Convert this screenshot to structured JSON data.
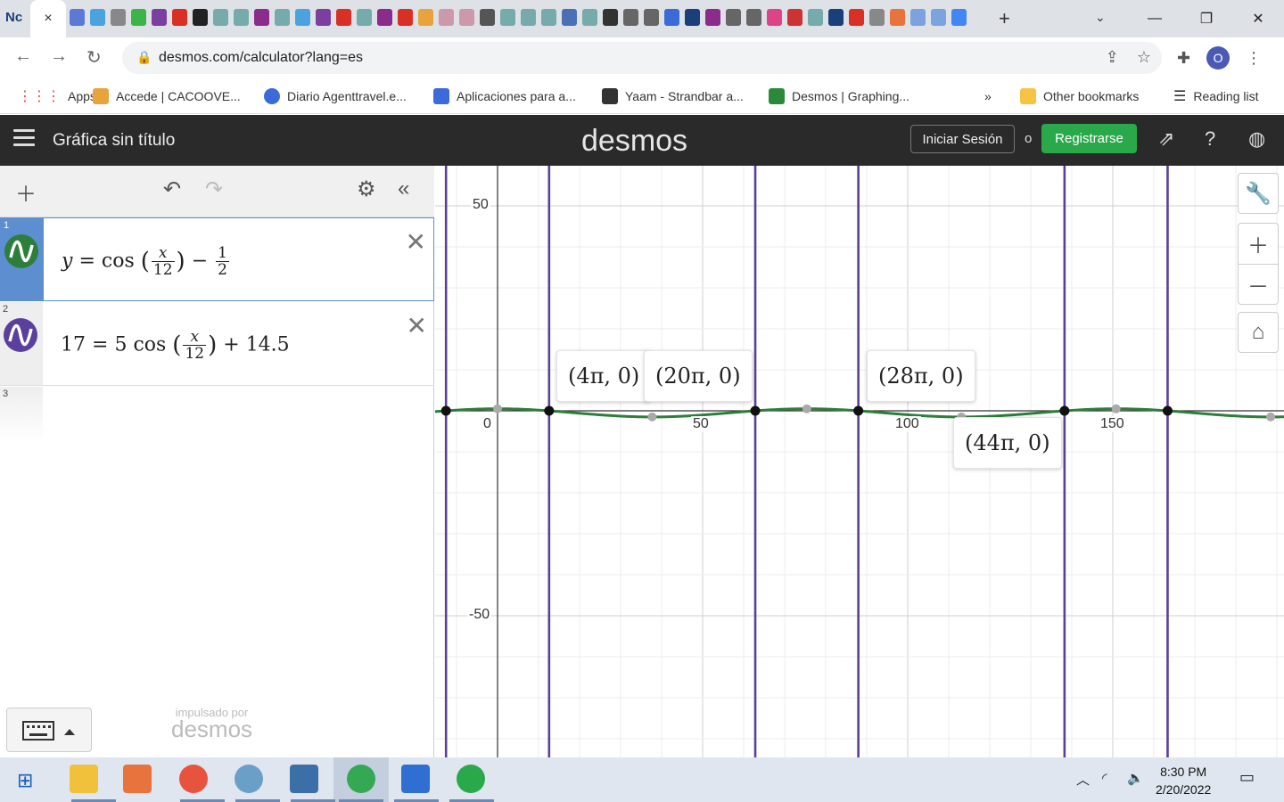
{
  "browser": {
    "active_tab_favicon": "Nc",
    "active_tab_close": "×",
    "url": "desmos.com/calculator?lang=es",
    "new_tab": "+",
    "minimize": "—",
    "restore": "❐",
    "close": "✕",
    "tab_search": "⌄",
    "profile_initial": "O",
    "bookmarks": [
      {
        "label": "Apps",
        "color": "#e94235"
      },
      {
        "label": "Accede | CACOOVE...",
        "color": "#e8a33d"
      },
      {
        "label": "Diario Agenttravel.e...",
        "color": "#3a6bd8"
      },
      {
        "label": "Aplicaciones para a...",
        "color": "#3a6bd8"
      },
      {
        "label": "Yaam - Strandbar a...",
        "color": "#333333"
      },
      {
        "label": "Desmos | Graphing...",
        "color": "#2a8a3a"
      }
    ],
    "more_bookmarks": "»",
    "other_bookmarks": "Other bookmarks",
    "reading_list": "Reading list"
  },
  "desmos_header": {
    "graph_title": "Gráfica sin título",
    "logo": "desmos",
    "login": "Iniciar Sesión",
    "or": "o",
    "register": "Registrarse",
    "accent": "#2aa94b"
  },
  "expressions": [
    {
      "index": "1",
      "color": "#2d7e3a",
      "active": true
    },
    {
      "index": "2",
      "color": "#5b3f9c",
      "active": false
    },
    {
      "index": "3"
    }
  ],
  "expr1": {
    "y": "y",
    "eq": "=",
    "cos": "cos",
    "num": "x",
    "den": "12",
    "minus": "−",
    "fnum": "1",
    "fden": "2"
  },
  "expr2": {
    "lhs": "17",
    "eq": "=",
    "coef": "5",
    "cos": "cos",
    "num": "x",
    "den": "12",
    "plus": "+",
    "c": "14.5"
  },
  "powered": {
    "small": "impulsado por",
    "logo": "desmos"
  },
  "graph": {
    "ticks_x": [
      "0",
      "50",
      "100",
      "150"
    ],
    "ticks_y": [
      "50",
      "-50"
    ],
    "point_labels": [
      "(4π, 0)",
      "(20π, 0)",
      "(28π, 0)",
      "(44π, 0)"
    ],
    "curve_color": "#2d7e3a",
    "line_color": "#5b3f9c"
  },
  "taskbar": {
    "time": "8:30 PM",
    "date": "2/20/2022"
  }
}
